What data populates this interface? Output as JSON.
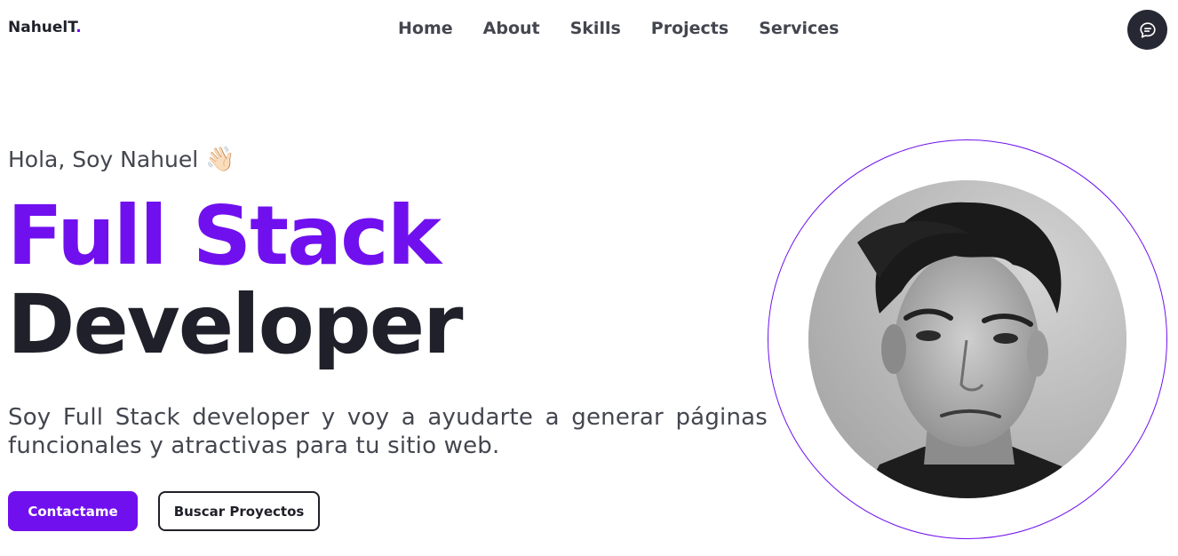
{
  "brand": {
    "name": "NahuelT",
    "dot": ".",
    "accent": "#7010ee"
  },
  "nav": {
    "items": [
      {
        "label": "Home"
      },
      {
        "label": "About"
      },
      {
        "label": "Skills"
      },
      {
        "label": "Projects"
      },
      {
        "label": "Services"
      }
    ]
  },
  "chat_button": {
    "icon": "chat-icon",
    "color": "#262833"
  },
  "hero": {
    "greeting": "Hola, Soy Nahuel",
    "greeting_emoji": "👋🏻",
    "title_line1": "Full Stack",
    "title_line2": "Developer",
    "description": "Soy Full Stack developer y voy a ayudarte a generar páginas funcionales y atractivas para tu sitio web.",
    "primary_button": "Contactame",
    "secondary_button": "Buscar Proyectos"
  },
  "profile_photo": {
    "alt": "profile-photo",
    "style": "grayscale portrait"
  }
}
